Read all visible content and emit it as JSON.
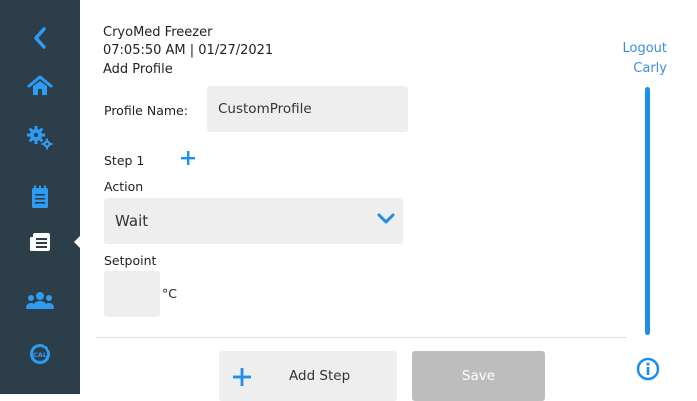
{
  "header": {
    "device_name": "CryoMed Freezer",
    "datetime": "07:05:50 AM | 01/27/2021",
    "page_title": "Add Profile"
  },
  "top_right": {
    "logout_label": "Logout",
    "user_name": "Carly"
  },
  "form": {
    "profile_name_label": "Profile Name:",
    "profile_name_value": "CustomProfile",
    "step_label": "Step 1",
    "action_label": "Action",
    "action_value": "Wait",
    "setpoint_label": "Setpoint",
    "setpoint_value": "",
    "setpoint_unit": "°C"
  },
  "buttons": {
    "add_step_label": "Add Step",
    "save_label": "Save"
  },
  "sidebar": {
    "items": [
      {
        "icon": "back-chevron-icon"
      },
      {
        "icon": "home-icon"
      },
      {
        "icon": "settings-gears-icon"
      },
      {
        "icon": "notepad-icon"
      },
      {
        "icon": "profiles-icon",
        "active": true
      },
      {
        "icon": "users-icon"
      },
      {
        "icon": "calibration-icon",
        "text": "CAL"
      }
    ]
  },
  "colors": {
    "sidebar_bg": "#2d3e4b",
    "accent": "#1e8ee8",
    "field_bg": "#eeeeee",
    "save_disabled": "#bdbdbd"
  }
}
